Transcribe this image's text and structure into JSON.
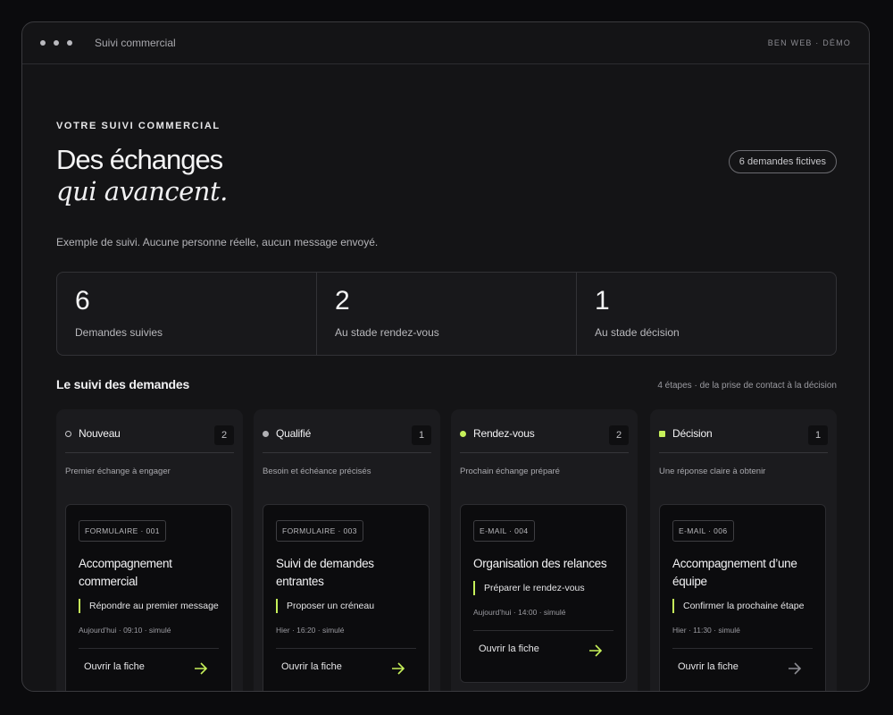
{
  "window": {
    "title": "Suivi commercial",
    "brand": "BEN WEB · DÉMO"
  },
  "hero": {
    "eyebrow": "VOTRE SUIVI COMMERCIAL",
    "title_line1": "Des échanges",
    "title_line2": "qui avancent.",
    "badge": "6 demandes fictives",
    "subtitle": "Exemple de suivi. Aucune personne réelle, aucun message envoyé."
  },
  "stats": [
    {
      "value": "6",
      "label": "Demandes suivies"
    },
    {
      "value": "2",
      "label": "Au stade rendez-vous"
    },
    {
      "value": "1",
      "label": "Au stade décision"
    }
  ],
  "pipeline": {
    "title": "Le suivi des demandes",
    "note": "4 étapes · de la prise de contact à la décision",
    "columns": [
      {
        "name": "Nouveau",
        "count": "2",
        "marker": "ring-icon",
        "description": "Premier échange à engager",
        "card": {
          "tag": "FORMULAIRE · 001",
          "title": "Accompagnement commercial",
          "action": "Répondre au premier message",
          "meta": "Aujourd’hui · 09:10 · simulé",
          "open": "Ouvrir la fiche",
          "arrow_color": "#c6f05a"
        }
      },
      {
        "name": "Qualifié",
        "count": "1",
        "marker": "dot-icon",
        "description": "Besoin et échéance précisés",
        "card": {
          "tag": "FORMULAIRE · 003",
          "title": "Suivi de demandes entrantes",
          "action": "Proposer un créneau",
          "meta": "Hier · 16:20 · simulé",
          "open": "Ouvrir la fiche",
          "arrow_color": "#c6f05a"
        }
      },
      {
        "name": "Rendez-vous",
        "count": "2",
        "marker": "lime-dot-icon",
        "description": "Prochain échange préparé",
        "card": {
          "tag": "E-MAIL · 004",
          "title": "Organisation des relances",
          "action": "Préparer le rendez-vous",
          "meta": "Aujourd’hui · 14:00 · simulé",
          "open": "Ouvrir la fiche",
          "arrow_color": "#c6f05a"
        }
      },
      {
        "name": "Décision",
        "count": "1",
        "marker": "lime-square-icon",
        "description": "Une réponse claire à obtenir",
        "card": {
          "tag": "E-MAIL · 006",
          "title": "Accompagnement d’une équipe",
          "action": "Confirmer la prochaine étape",
          "meta": "Hier · 11:30 · simulé",
          "open": "Ouvrir la fiche",
          "arrow_color": "#8a8a90"
        }
      }
    ]
  }
}
